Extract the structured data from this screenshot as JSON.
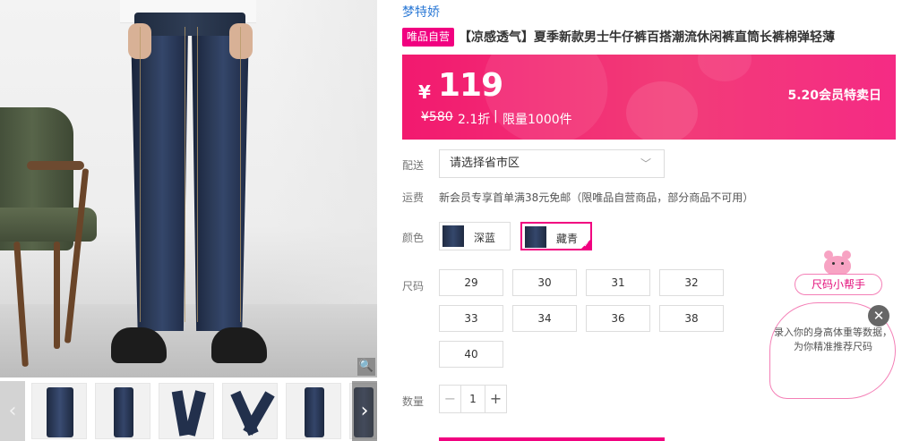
{
  "gallery": {
    "zoom_icon": "magnifier-icon",
    "prev_icon": "chevron-left-icon",
    "next_icon": "chevron-right-icon",
    "prev_glyph": "‹",
    "next_glyph": "›",
    "zoom_glyph": "🔍",
    "thumbnails": [
      "jeans-back",
      "jeans-front",
      "jeans-side",
      "jeans-walk",
      "jeans-stand",
      "jeans-detail"
    ]
  },
  "product": {
    "brand": "梦特娇",
    "badge": "唯品自营",
    "title": "【凉感透气】夏季新款男士牛仔裤百搭潮流休闲裤直筒长裤棉弹轻薄"
  },
  "price_panel": {
    "currency": "¥",
    "price": "119",
    "old_price": "¥580",
    "discount": "2.1折",
    "separator": "|",
    "limit": "限量1000件",
    "event": "5.20会员特卖日",
    "accent": "#f2196f"
  },
  "delivery": {
    "label": "配送",
    "placeholder": "请选择省市区",
    "chevron_glyph": "﹀"
  },
  "shipping": {
    "label": "运费",
    "text": "新会员专享首单满38元免邮（限唯品自营商品，部分商品不可用）"
  },
  "color": {
    "label": "颜色",
    "options": [
      {
        "name": "深蓝",
        "selected": false
      },
      {
        "name": "藏青",
        "selected": true
      }
    ],
    "check_glyph": "✓"
  },
  "size": {
    "label": "尺码",
    "options": [
      "29",
      "30",
      "31",
      "32",
      "33",
      "34",
      "36",
      "38",
      "40"
    ]
  },
  "quantity": {
    "label": "数量",
    "value": "1",
    "minus": "−",
    "plus": "+"
  },
  "helper": {
    "button": "尺码小帮手",
    "text": "录入你的身高体重等数据，为你精准推荐尺码",
    "close": "✕",
    "accent": "#f10180"
  }
}
